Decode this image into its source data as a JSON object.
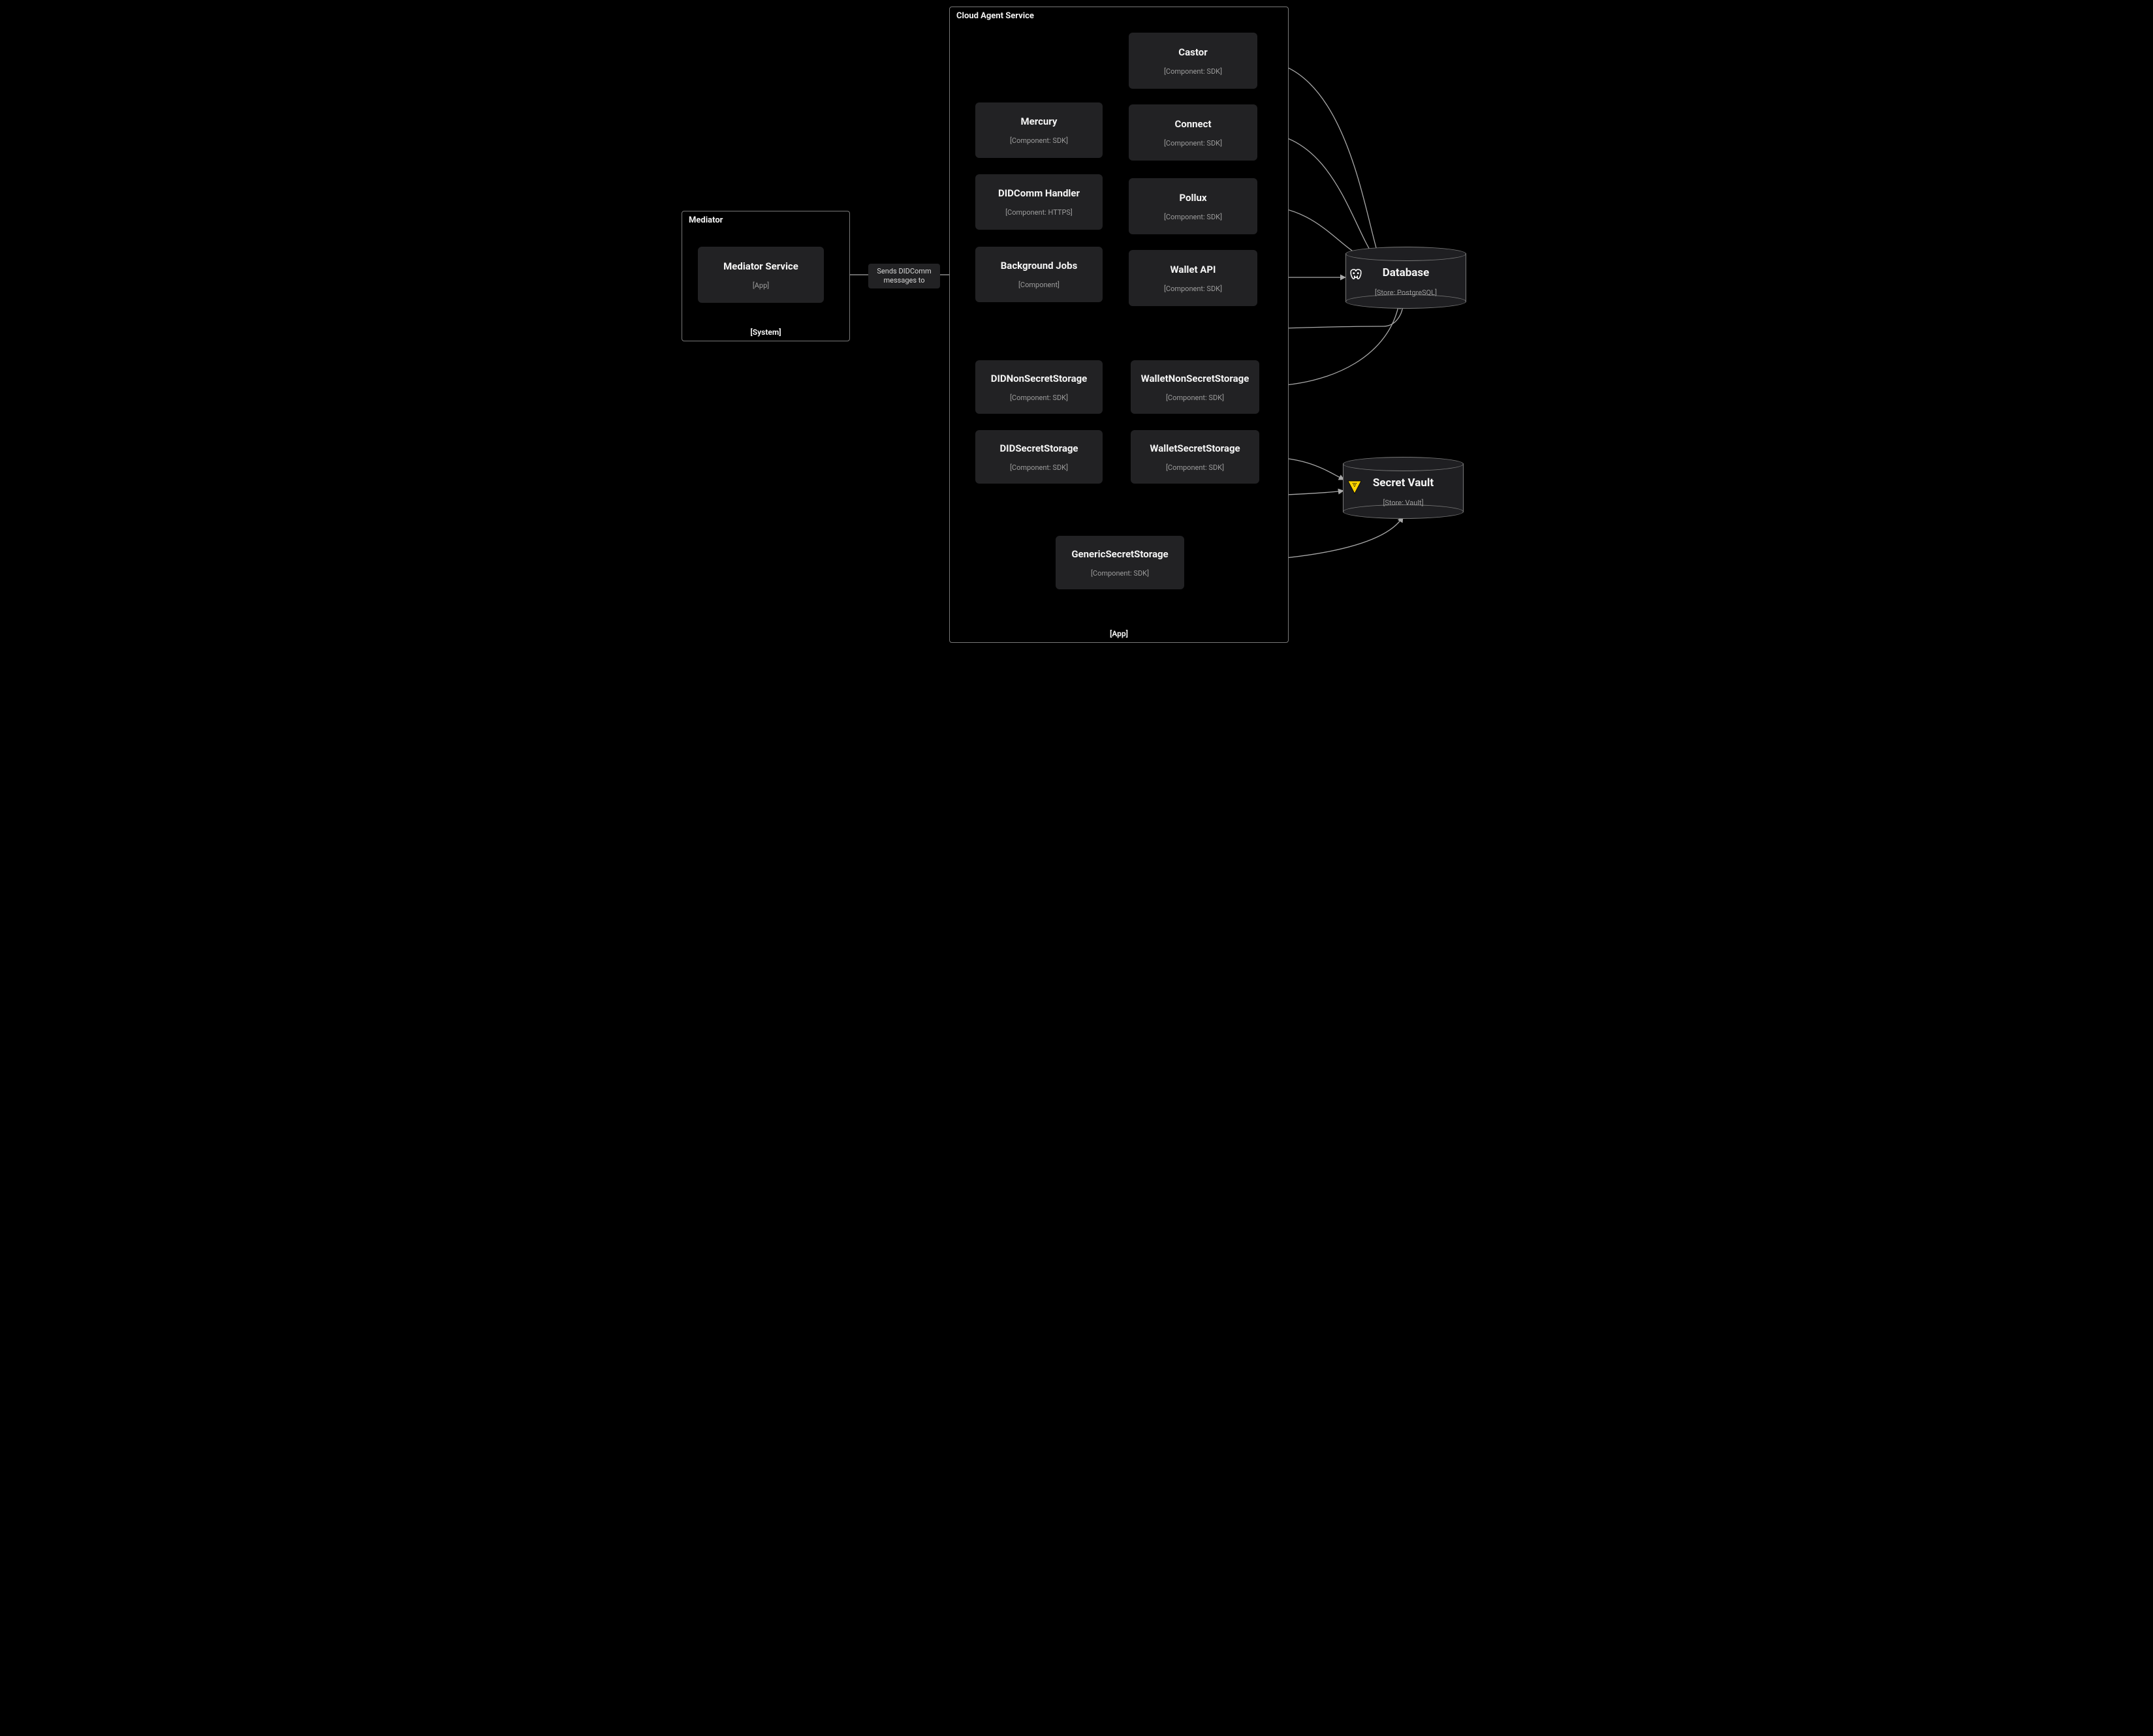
{
  "containers": {
    "mediator": {
      "title": "Mediator",
      "footer": "[System]"
    },
    "cloud_agent": {
      "title": "Cloud Agent Service",
      "footer": "[App]"
    }
  },
  "nodes": {
    "mediator_service": {
      "title": "Mediator Service",
      "sub": "[App]"
    },
    "mercury": {
      "title": "Mercury",
      "sub": "[Component: SDK]"
    },
    "didcomm_handler": {
      "title": "DIDComm Handler",
      "sub": "[Component: HTTPS]"
    },
    "background_jobs": {
      "title": "Background Jobs",
      "sub": "[Component]"
    },
    "castor": {
      "title": "Castor",
      "sub": "[Component: SDK]"
    },
    "connect": {
      "title": "Connect",
      "sub": "[Component: SDK]"
    },
    "pollux": {
      "title": "Pollux",
      "sub": "[Component: SDK]"
    },
    "wallet_api": {
      "title": "Wallet API",
      "sub": "[Component: SDK]"
    },
    "did_nonsecret": {
      "title": "DIDNonSecretStorage",
      "sub": "[Component: SDK]"
    },
    "wallet_nonsecret": {
      "title": "WalletNonSecretStorage",
      "sub": "[Component: SDK]"
    },
    "did_secret": {
      "title": "DIDSecretStorage",
      "sub": "[Component: SDK]"
    },
    "wallet_secret": {
      "title": "WalletSecretStorage",
      "sub": "[Component: SDK]"
    },
    "generic_secret": {
      "title": "GenericSecretStorage",
      "sub": "[Component: SDK]"
    }
  },
  "stores": {
    "database": {
      "title": "Database",
      "sub": "[Store: PostgreSQL]",
      "icon": "postgres"
    },
    "vault": {
      "title": "Secret Vault",
      "sub": "[Store: Vault]",
      "icon": "vault"
    }
  },
  "edges": {
    "bgjobs_to_mediator": {
      "label": "Sends DIDComm\nmessages to"
    }
  }
}
